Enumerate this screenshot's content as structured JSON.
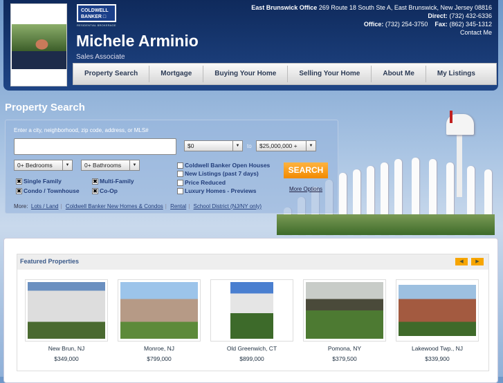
{
  "header": {
    "logo_text": "COLDWELL BANKER",
    "logo_sub": "RESIDENTIAL BROKERAGE",
    "name": "Michele Arminio",
    "title": "Sales Associate",
    "office_label": "East Brunswick Office",
    "office_address": "269 Route 18 South Ste A, East Brunswick, New Jersey 08816",
    "direct_label": "Direct:",
    "direct": "(732) 432-6336",
    "office_phone_label": "Office:",
    "office_phone": "(732) 254-3750",
    "fax_label": "Fax:",
    "fax": "(862) 345-1312",
    "contact": "Contact Me"
  },
  "nav": [
    "Property Search",
    "Mortgage",
    "Buying Your Home",
    "Selling Your Home",
    "About Me",
    "My Listings"
  ],
  "search": {
    "heading": "Property Search",
    "label": "Enter a city, neighborhood, zip code, address, or MLS#",
    "query": "",
    "price_min": "$0",
    "to": "to",
    "price_max": "$25,000,000 +",
    "bedrooms": "0+ Bedrooms",
    "bathrooms": "0+ Bathrooms",
    "types": [
      {
        "label": "Single Family",
        "checked": true
      },
      {
        "label": "Multi-Family",
        "checked": true
      },
      {
        "label": "Condo / Townhouse",
        "checked": true
      },
      {
        "label": "Co-Op",
        "checked": true
      }
    ],
    "filters": [
      "Coldwell Banker Open Houses",
      "New Listings (past 7 days)",
      "Price Reduced",
      "Luxury Homes - Previews"
    ],
    "button": "SEARCH",
    "more_options": "More Options",
    "more_label": "More:",
    "more_links": [
      "Lots / Land",
      "Coldwell Banker New Homes & Condos",
      "Rental",
      "School District (NJ/NY only)"
    ]
  },
  "featured": {
    "title": "Featured Properties",
    "items": [
      {
        "location": "New Brun, NJ",
        "price": "$349,000"
      },
      {
        "location": "Monroe, NJ",
        "price": "$799,000"
      },
      {
        "location": "Old Greenwich, CT",
        "price": "$899,000"
      },
      {
        "location": "Pomona, NY",
        "price": "$379,500"
      },
      {
        "location": "Lakewood Twp., NJ",
        "price": "$339,900"
      }
    ]
  },
  "colors": {
    "header": "#1a3a74",
    "accent": "#f7a500"
  }
}
